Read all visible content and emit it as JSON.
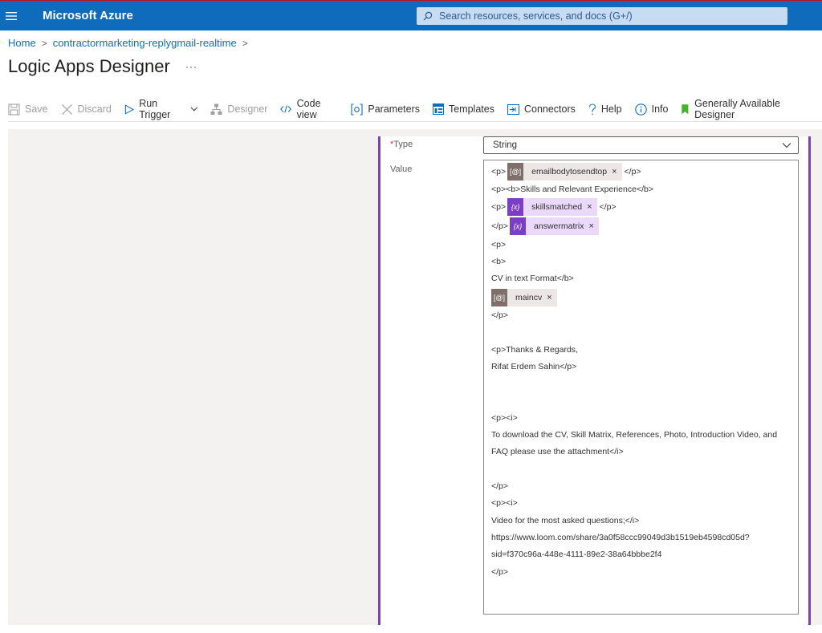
{
  "header": {
    "app_title": "Microsoft Azure",
    "search_placeholder": "Search resources, services, and docs (G+/)"
  },
  "breadcrumb": {
    "home": "Home",
    "resource": "contractormarketing-replygmail-realtime"
  },
  "page": {
    "title": "Logic Apps Designer",
    "more": "···"
  },
  "toolbar": {
    "save": "Save",
    "discard": "Discard",
    "run_trigger": "Run Trigger",
    "designer": "Designer",
    "code_view": "Code view",
    "parameters": "Parameters",
    "templates": "Templates",
    "connectors": "Connectors",
    "help": "Help",
    "info": "Info",
    "ga_designer": "Generally Available Designer"
  },
  "form": {
    "type_label": "Type",
    "type_value": "String",
    "value_label": "Value"
  },
  "value_lines": {
    "l1_pre": "<p>",
    "l1_token": "emailbodytosendtop",
    "l1_post": "</p>",
    "l2": "<p><b>Skills and Relevant Experience</b>",
    "l3_pre": "<p>",
    "l3_token": "skillsmatched",
    "l3_post": "</p>",
    "l4_pre": "</p>",
    "l4_token": "answermatrix",
    "l5": "<p>",
    "l6": "<b>",
    "l7": "CV in text Format</b>",
    "l8_token": "maincv",
    "l9": "</p>",
    "l10": "<p>Thanks & Regards,",
    "l11": "Rifat Erdem Sahin</p>",
    "l12": "<p><i>",
    "l13": "To download the CV, Skill Matrix, References, Photo, Introduction Video, and",
    "l14": "FAQ please use the attachment</i>",
    "l15": "</p>",
    "l16": "<p><i>",
    "l17": "Video for the most asked questions;</i>",
    "l18": "https://www.loom.com/share/3a0f58ccc99049d3b1519eb4598cd05d?",
    "l19": "sid=f370c96a-448e-4111-89e2-38a64bbbe2f4",
    "l20": "</p>"
  },
  "token_close": "×",
  "colors": {
    "azure_blue": "#0f6cbd",
    "variable_purple": "#7a3fc4",
    "body_token_brown": "#7f6f6a"
  }
}
